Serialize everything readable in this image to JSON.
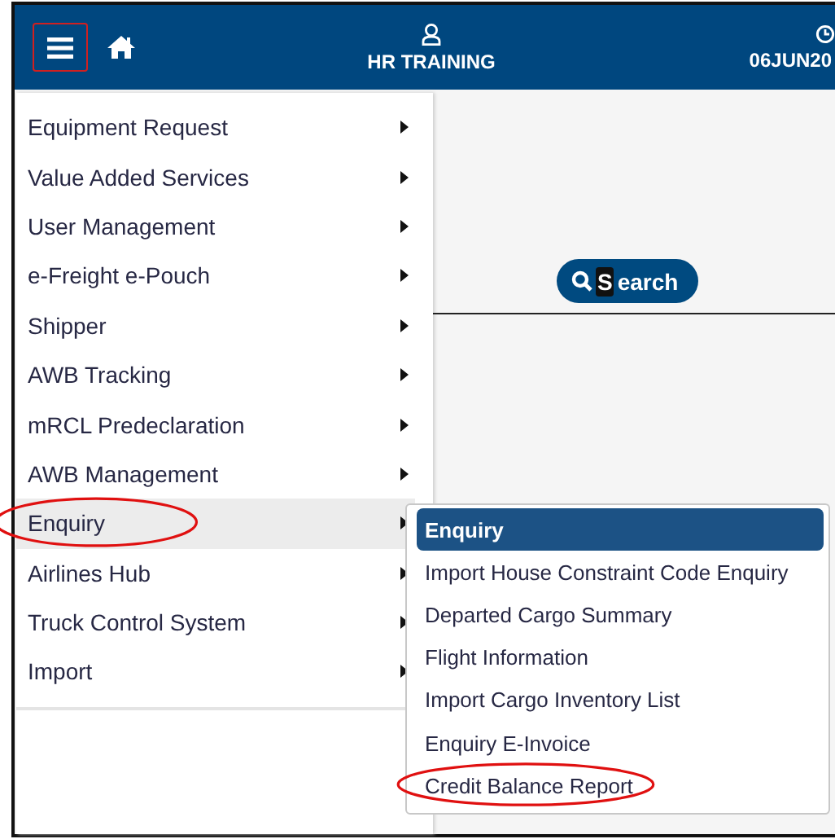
{
  "header": {
    "menu_button": {
      "outlined": true
    },
    "user": "HR TRAINING",
    "date": "06JUN20"
  },
  "menu": {
    "items": [
      {
        "label": "Equipment Request",
        "selected": false,
        "circled": false
      },
      {
        "label": "Value Added Services",
        "selected": false,
        "circled": false
      },
      {
        "label": "User Management",
        "selected": false,
        "circled": false
      },
      {
        "label": "e-Freight e-Pouch",
        "selected": false,
        "circled": false
      },
      {
        "label": "Shipper",
        "selected": false,
        "circled": false
      },
      {
        "label": "AWB Tracking",
        "selected": false,
        "circled": false
      },
      {
        "label": "mRCL Predeclaration",
        "selected": false,
        "circled": false
      },
      {
        "label": "AWB Management",
        "selected": false,
        "circled": false
      },
      {
        "label": "Enquiry",
        "selected": true,
        "circled": true
      },
      {
        "label": "Airlines Hub",
        "selected": false,
        "circled": false
      },
      {
        "label": "Truck Control System",
        "selected": false,
        "circled": false
      },
      {
        "label": "Import",
        "selected": false,
        "circled": false
      }
    ]
  },
  "submenu": {
    "items": [
      {
        "label": "Enquiry",
        "selected": true,
        "circled": false
      },
      {
        "label": "Import House Constraint Code Enquiry",
        "selected": false,
        "circled": false
      },
      {
        "label": "Departed Cargo Summary",
        "selected": false,
        "circled": false
      },
      {
        "label": "Flight Information",
        "selected": false,
        "circled": false
      },
      {
        "label": "Import Cargo Inventory List",
        "selected": false,
        "circled": false
      },
      {
        "label": "Enquiry E-Invoice",
        "selected": false,
        "circled": false
      },
      {
        "label": "Credit Balance Report",
        "selected": false,
        "circled": true
      }
    ]
  },
  "search_button": {
    "key_letter": "S",
    "rest": "earch"
  }
}
